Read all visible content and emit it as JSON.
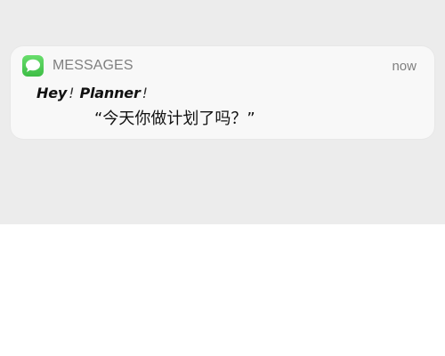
{
  "notification": {
    "app_name": "MESSAGES",
    "time": "now",
    "title_part1": "Hey",
    "title_excl1": "!",
    "title_part2": "Planner",
    "title_excl2": "!",
    "message": "“今天你做计划了吗？”",
    "icon": "messages-app-icon",
    "accent": "#4cd154"
  }
}
